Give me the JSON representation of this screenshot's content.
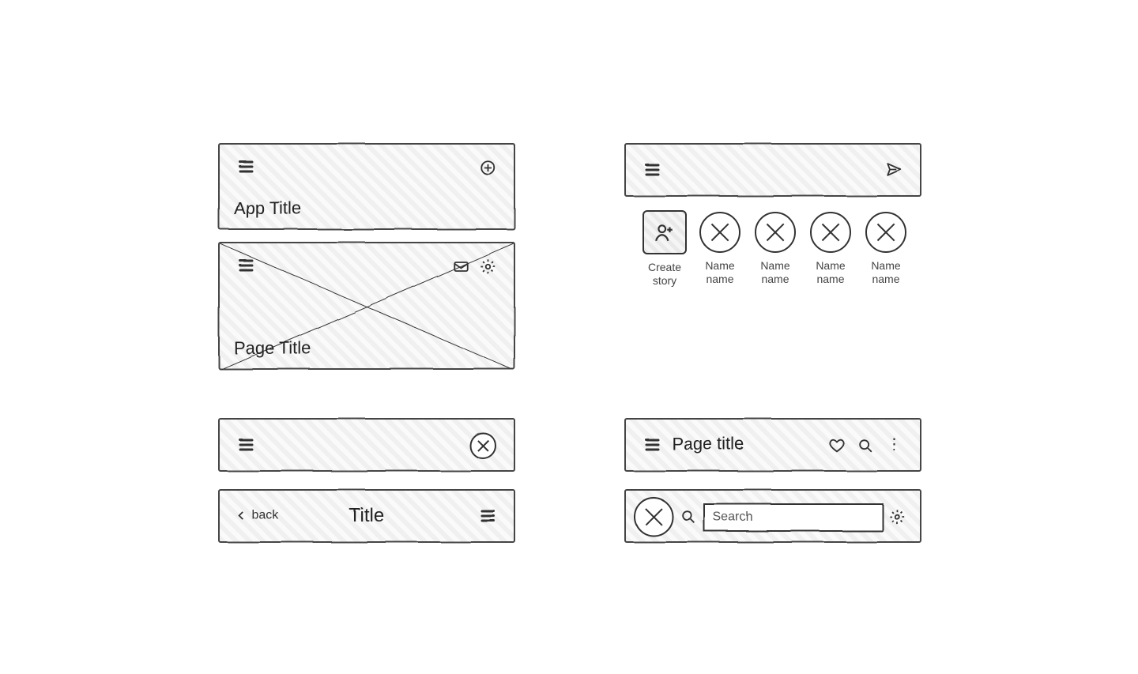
{
  "left": {
    "appbar1_title": "App Title",
    "appbar2_title": "Page Title",
    "appbar4_back": "back",
    "appbar4_title": "Title"
  },
  "right": {
    "stories": {
      "create_label": "Create story",
      "items": [
        "Name name",
        "Name name",
        "Name name",
        "Name name"
      ]
    },
    "appbar2_title": "Page title",
    "search_placeholder": "Search"
  }
}
